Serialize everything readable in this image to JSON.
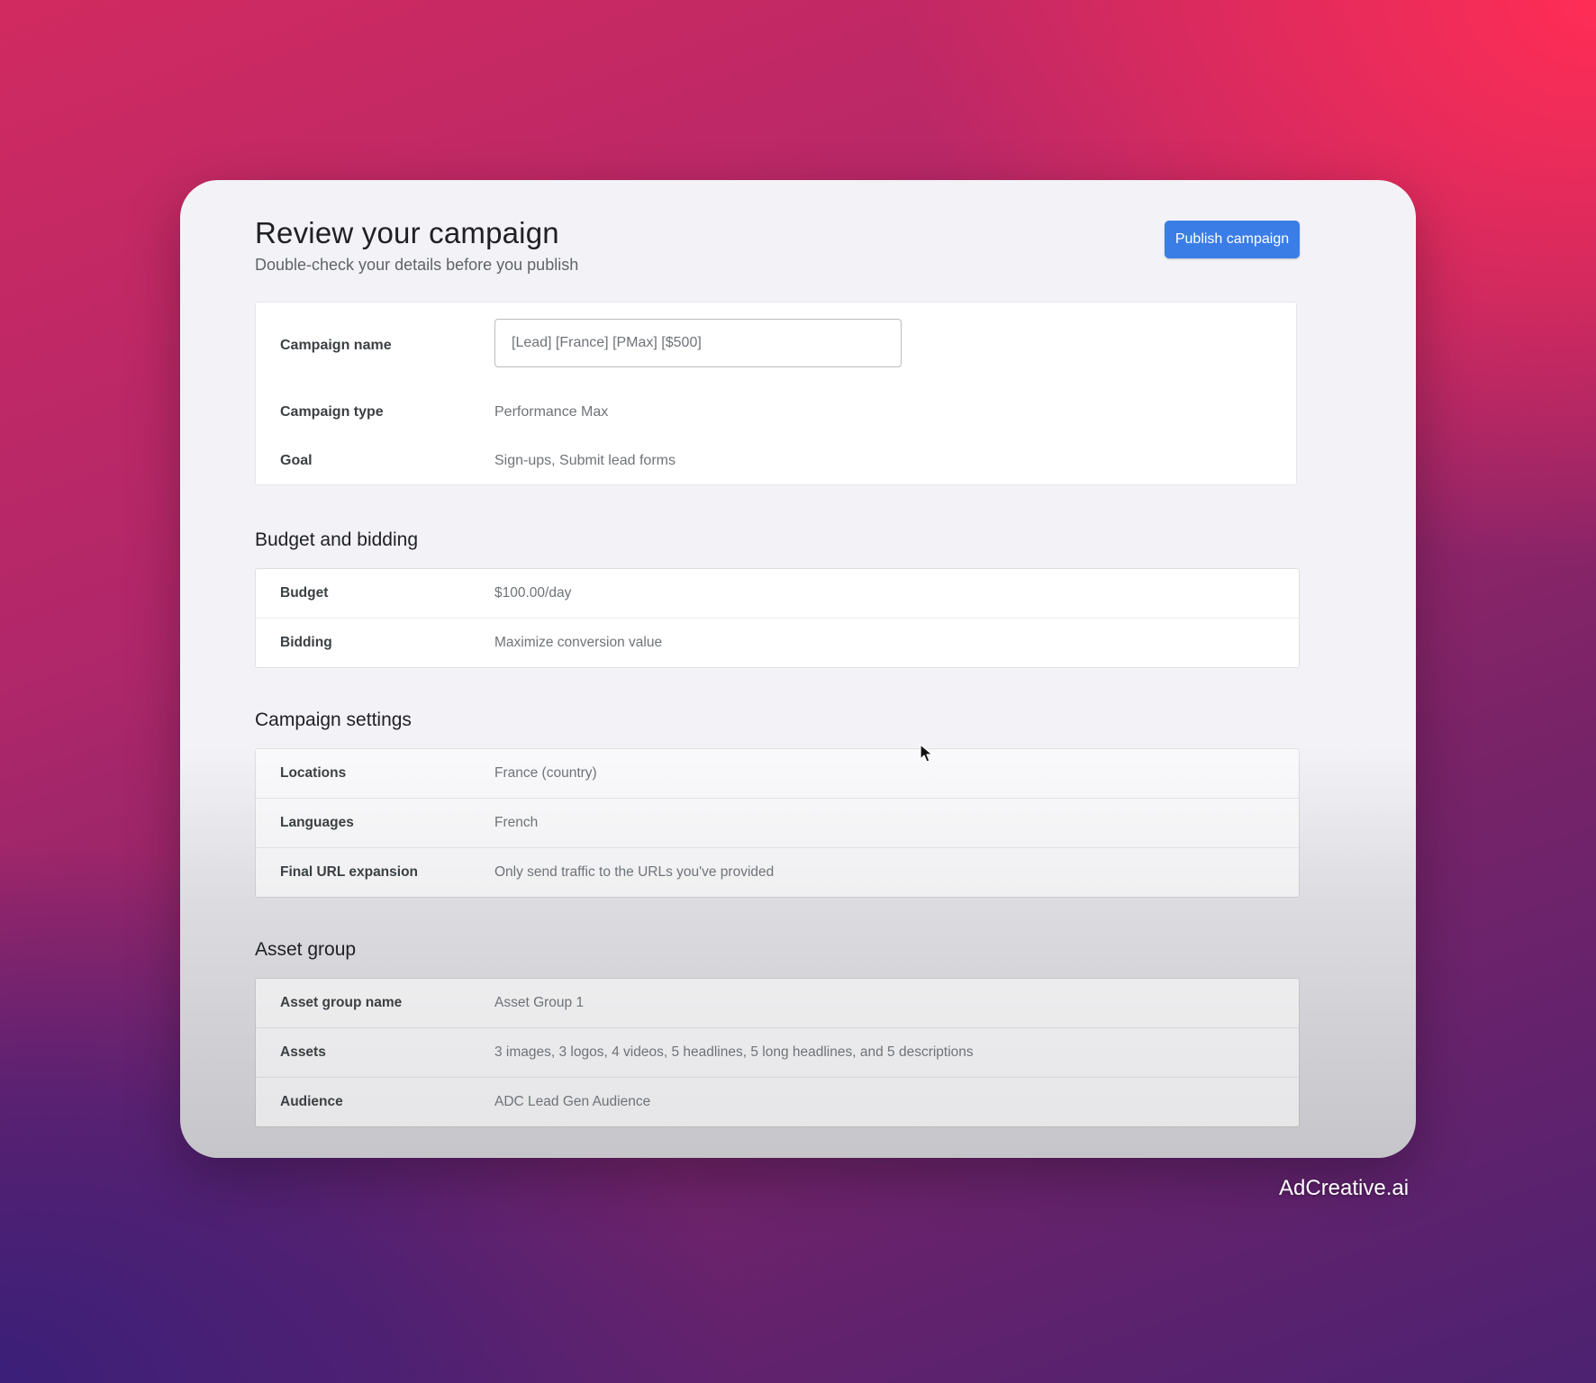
{
  "header": {
    "title": "Review your campaign",
    "subtitle": "Double-check your details before you publish",
    "publish_label": "Publish campaign"
  },
  "overview": {
    "campaign_name": {
      "label": "Campaign name",
      "value": "[Lead] [France] [PMax] [$500]"
    },
    "campaign_type": {
      "label": "Campaign type",
      "value": "Performance Max"
    },
    "goal": {
      "label": "Goal",
      "value": "Sign-ups, Submit lead forms"
    }
  },
  "budget_section": {
    "heading": "Budget and bidding",
    "rows": [
      {
        "label": "Budget",
        "value": "$100.00/day"
      },
      {
        "label": "Bidding",
        "value": "Maximize conversion value"
      }
    ]
  },
  "settings_section": {
    "heading": "Campaign settings",
    "rows": [
      {
        "label": "Locations",
        "value": "France (country)"
      },
      {
        "label": "Languages",
        "value": "French"
      },
      {
        "label": "Final URL expansion",
        "value": "Only send traffic to the URLs you've provided"
      }
    ]
  },
  "asset_section": {
    "heading": "Asset group",
    "rows": [
      {
        "label": "Asset group name",
        "value": "Asset Group 1"
      },
      {
        "label": "Assets",
        "value": "3 images, 3 logos, 4 videos, 5 headlines, 5 long headlines, and 5 descriptions"
      },
      {
        "label": "Audience",
        "value": "ADC Lead Gen Audience"
      }
    ]
  },
  "brand": "AdCreative.ai",
  "colors": {
    "primary_button": "#3b7de6"
  }
}
